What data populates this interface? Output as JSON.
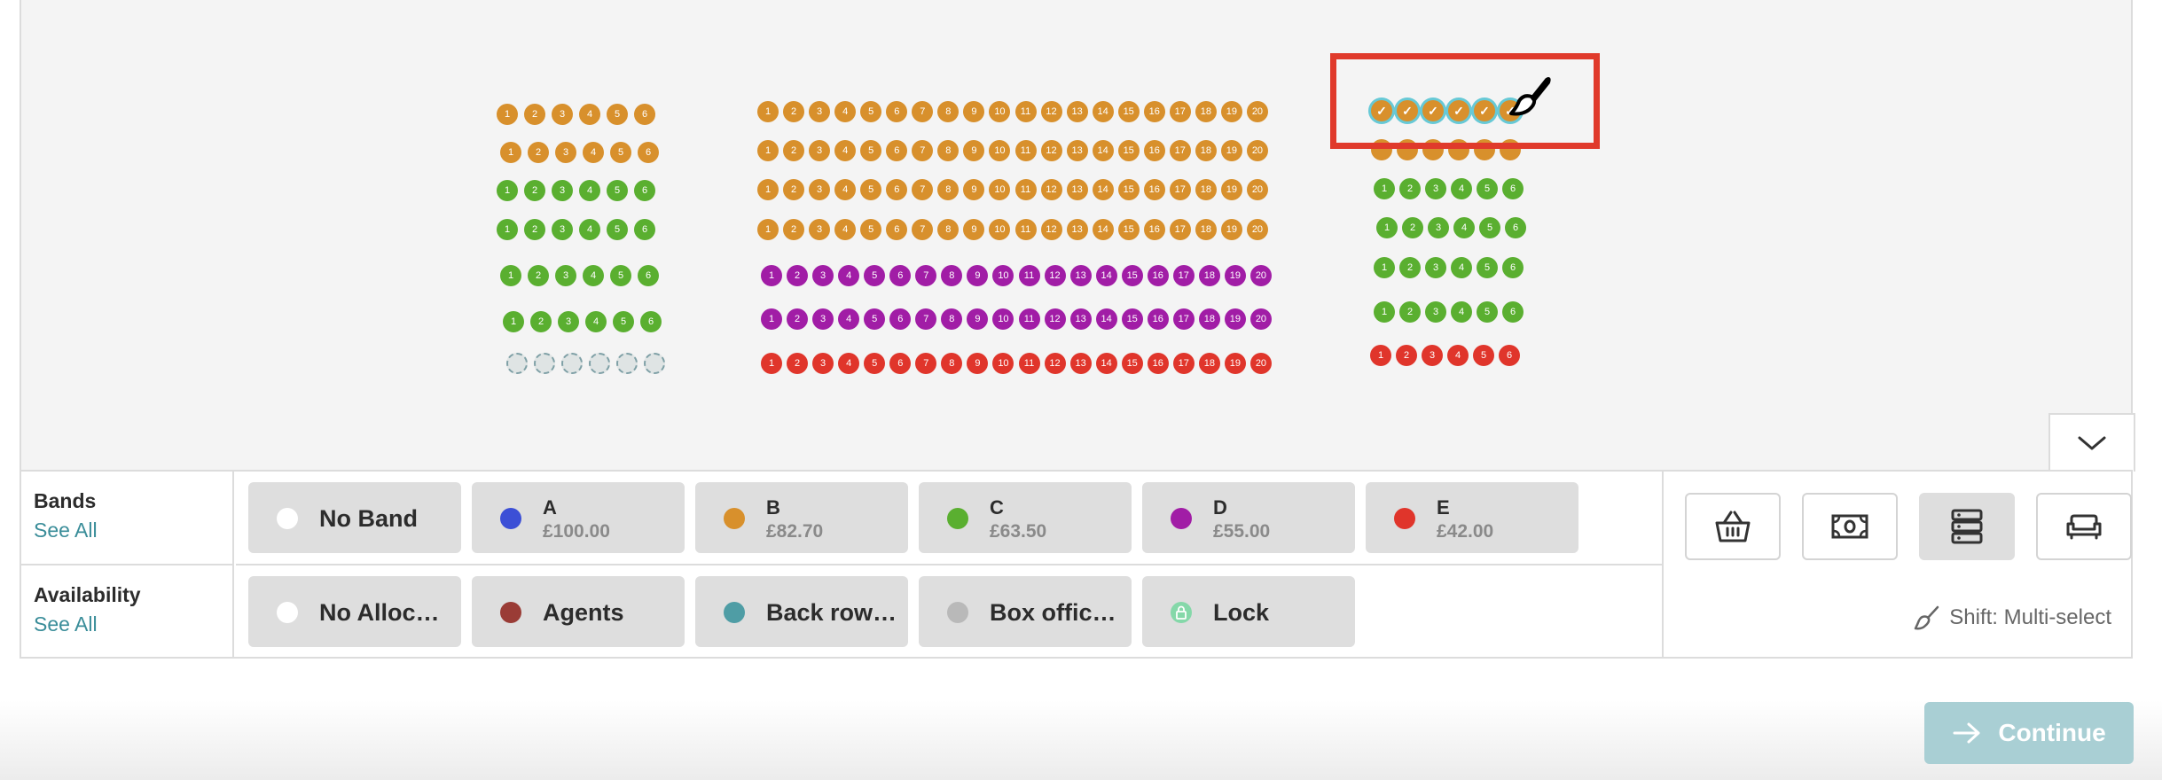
{
  "colors": {
    "A": "#3c4fd6",
    "B": "#d8902c",
    "C": "#5aaf30",
    "D": "#a11da6",
    "E": "#e0352b",
    "no_band": "#ffffff",
    "no_allocation": "#ffffff",
    "agents": "#9a3c36",
    "back_row": "#4f9da5",
    "box_office": "#b9b9b9",
    "lock": "#85d8a9"
  },
  "seatmap": {
    "blocks": [
      {
        "name": "left",
        "rows": [
          {
            "band": "B",
            "seats": [
              "1",
              "2",
              "3",
              "4",
              "5",
              "6"
            ]
          },
          {
            "band": "B",
            "seats": [
              "1",
              "2",
              "3",
              "4",
              "5",
              "6"
            ]
          },
          {
            "band": "C",
            "seats": [
              "1",
              "2",
              "3",
              "4",
              "5",
              "6"
            ]
          },
          {
            "band": "C",
            "seats": [
              "1",
              "2",
              "3",
              "4",
              "5",
              "6"
            ]
          },
          {
            "band": "C",
            "seats": [
              "1",
              "2",
              "3",
              "4",
              "5",
              "6"
            ]
          },
          {
            "band": "C",
            "seats": [
              "1",
              "2",
              "3",
              "4",
              "5",
              "6"
            ]
          },
          {
            "band": "empty",
            "seats": [
              "",
              "",
              "",
              "",
              "",
              ""
            ]
          }
        ]
      },
      {
        "name": "centre",
        "rows": [
          {
            "band": "B",
            "seats": [
              "1",
              "2",
              "3",
              "4",
              "5",
              "6",
              "7",
              "8",
              "9",
              "10",
              "11",
              "12",
              "13",
              "14",
              "15",
              "16",
              "17",
              "18",
              "19",
              "20"
            ]
          },
          {
            "band": "B",
            "seats": [
              "1",
              "2",
              "3",
              "4",
              "5",
              "6",
              "7",
              "8",
              "9",
              "10",
              "11",
              "12",
              "13",
              "14",
              "15",
              "16",
              "17",
              "18",
              "19",
              "20"
            ]
          },
          {
            "band": "B",
            "seats": [
              "1",
              "2",
              "3",
              "4",
              "5",
              "6",
              "7",
              "8",
              "9",
              "10",
              "11",
              "12",
              "13",
              "14",
              "15",
              "16",
              "17",
              "18",
              "19",
              "20"
            ]
          },
          {
            "band": "B",
            "seats": [
              "1",
              "2",
              "3",
              "4",
              "5",
              "6",
              "7",
              "8",
              "9",
              "10",
              "11",
              "12",
              "13",
              "14",
              "15",
              "16",
              "17",
              "18",
              "19",
              "20"
            ]
          },
          {
            "band": "D",
            "seats": [
              "1",
              "2",
              "3",
              "4",
              "5",
              "6",
              "7",
              "8",
              "9",
              "10",
              "11",
              "12",
              "13",
              "14",
              "15",
              "16",
              "17",
              "18",
              "19",
              "20"
            ]
          },
          {
            "band": "D",
            "seats": [
              "1",
              "2",
              "3",
              "4",
              "5",
              "6",
              "7",
              "8",
              "9",
              "10",
              "11",
              "12",
              "13",
              "14",
              "15",
              "16",
              "17",
              "18",
              "19",
              "20"
            ]
          },
          {
            "band": "E",
            "seats": [
              "1",
              "2",
              "3",
              "4",
              "5",
              "6",
              "7",
              "8",
              "9",
              "10",
              "11",
              "12",
              "13",
              "14",
              "15",
              "16",
              "17",
              "18",
              "19",
              "20"
            ]
          }
        ]
      },
      {
        "name": "right",
        "rows": [
          {
            "band": "B",
            "selected": true,
            "seats": [
              "✓",
              "✓",
              "✓",
              "✓",
              "✓",
              "✓"
            ]
          },
          {
            "band": "B",
            "seats": [
              "",
              "",
              "",
              "",
              "",
              ""
            ]
          },
          {
            "band": "C",
            "seats": [
              "1",
              "2",
              "3",
              "4",
              "5",
              "6"
            ]
          },
          {
            "band": "C",
            "seats": [
              "1",
              "2",
              "3",
              "4",
              "5",
              "6"
            ]
          },
          {
            "band": "C",
            "seats": [
              "1",
              "2",
              "3",
              "4",
              "5",
              "6"
            ]
          },
          {
            "band": "C",
            "seats": [
              "1",
              "2",
              "3",
              "4",
              "5",
              "6"
            ]
          },
          {
            "band": "E",
            "seats": [
              "1",
              "2",
              "3",
              "4",
              "5",
              "6"
            ]
          }
        ]
      }
    ]
  },
  "bands": {
    "title": "Bands",
    "see_all": "See All",
    "chips": [
      {
        "key": "no_band",
        "label": "No Band"
      },
      {
        "key": "A",
        "name": "A",
        "price": "£100.00"
      },
      {
        "key": "B",
        "name": "B",
        "price": "£82.70"
      },
      {
        "key": "C",
        "name": "C",
        "price": "£63.50"
      },
      {
        "key": "D",
        "name": "D",
        "price": "£55.00"
      },
      {
        "key": "E",
        "name": "E",
        "price": "£42.00"
      }
    ]
  },
  "availability": {
    "title": "Availability",
    "see_all": "See All",
    "chips": [
      {
        "key": "no_allocation",
        "label": "No Alloc…"
      },
      {
        "key": "agents",
        "label": "Agents"
      },
      {
        "key": "back_row",
        "label": "Back row…"
      },
      {
        "key": "box_office",
        "label": "Box offic…"
      },
      {
        "key": "lock",
        "label": "Lock"
      }
    ]
  },
  "tools": {
    "buttons": [
      {
        "icon": "basket-icon",
        "active": false
      },
      {
        "icon": "banknote-icon",
        "active": false
      },
      {
        "icon": "server-stack-icon",
        "active": true
      },
      {
        "icon": "sofa-icon",
        "active": false
      }
    ],
    "multi_select": "Shift: Multi-select"
  },
  "continue": {
    "label": "Continue"
  }
}
